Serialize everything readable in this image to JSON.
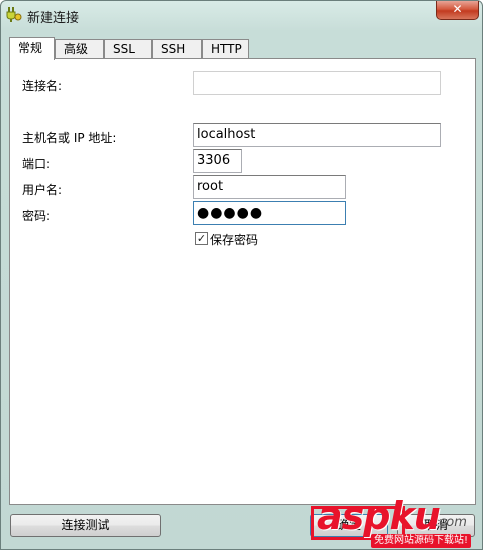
{
  "window": {
    "title": "新建连接",
    "close_glyph": "✕"
  },
  "tabs": [
    {
      "label": "常规",
      "active": true
    },
    {
      "label": "高级",
      "active": false
    },
    {
      "label": "SSL",
      "active": false
    },
    {
      "label": "SSH",
      "active": false
    },
    {
      "label": "HTTP",
      "active": false
    }
  ],
  "form": {
    "connection_name": {
      "label": "连接名:",
      "value": ""
    },
    "host": {
      "label": "主机名或 IP 地址:",
      "value": "localhost"
    },
    "port": {
      "label": "端口:",
      "value": "3306"
    },
    "username": {
      "label": "用户名:",
      "value": "root"
    },
    "password": {
      "label": "密码:",
      "masked_value": "●●●●●"
    },
    "save_password": {
      "label": "保存密码",
      "checked": true,
      "check_glyph": "✓"
    }
  },
  "buttons": {
    "test_connection": "连接测试",
    "ok": "确定",
    "cancel": "取消"
  },
  "watermark": {
    "logo": "aspku",
    "dotcom": ".com",
    "subtitle": "免费网站源码下载站!",
    "color": "#e8132b"
  },
  "icons": {
    "app": "connection-plug-icon",
    "close": "close-icon",
    "check": "checkmark-icon"
  }
}
